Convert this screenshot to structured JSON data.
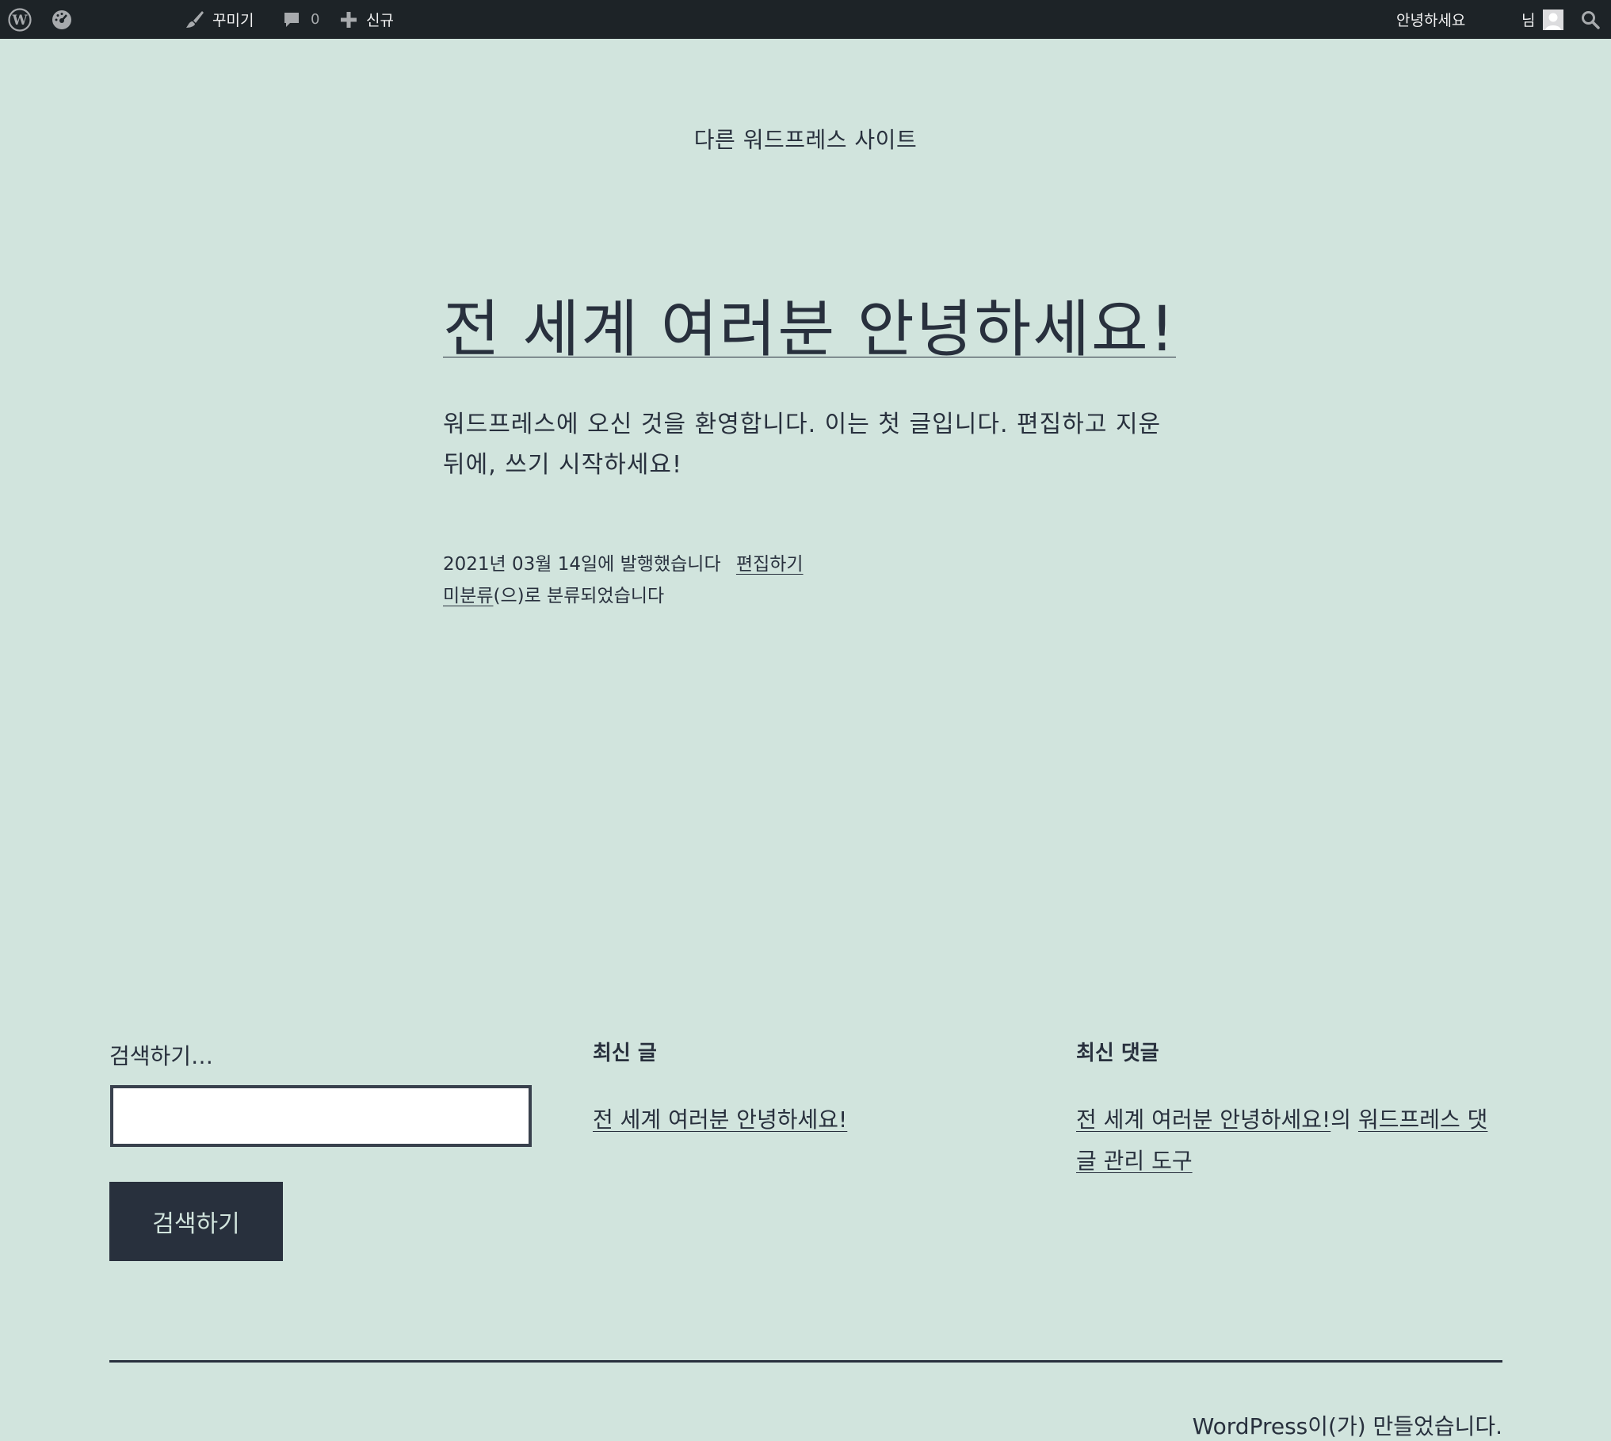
{
  "adminbar": {
    "customize_label": "꾸미기",
    "comments_count": "0",
    "new_label": "신규",
    "greeting": "안녕하세요",
    "user_suffix": "님"
  },
  "site": {
    "title": "다른 워드프레스 사이트"
  },
  "post": {
    "title": "전 세계 여러분 안녕하세요!",
    "content": "워드프레스에 오신 것을 환영합니다. 이는 첫 글입니다. 편집하고 지운 뒤에, 쓰기 시작하세요!",
    "published": "2021년 03월 14일에 발행했습니다",
    "edit_link": "편집하기",
    "category_link": "미분류",
    "category_suffix": "(으)로 분류되었습니다"
  },
  "widgets": {
    "search": {
      "label": "검색하기…",
      "button": "검색하기"
    },
    "recent_posts": {
      "title": "최신 글",
      "items": [
        "전 세계 여러분 안녕하세요!"
      ]
    },
    "recent_comments": {
      "title": "최신 댓글",
      "post_link": "전 세계 여러분 안녕하세요!",
      "connector": "의",
      "author_link": "워드프레스 댓글 관리 도구"
    }
  },
  "footer": {
    "powered_by": "WordPress이(가) 만들었습니다."
  }
}
